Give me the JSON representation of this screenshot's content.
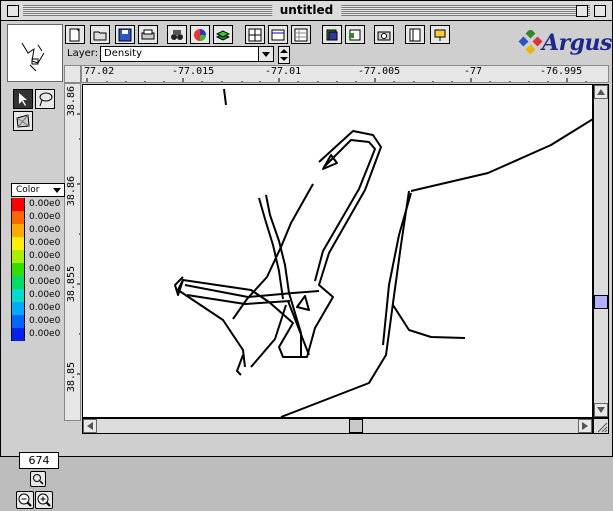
{
  "window": {
    "title": "untitled"
  },
  "toolbar": {
    "layer_label": "Layer:",
    "layer_value": "Density",
    "brand": "Argus"
  },
  "ruler_top": [
    "77.02",
    "-77.015",
    "-77.01",
    "-77.005",
    "-77",
    "-76.995"
  ],
  "ruler_left": [
    "38.86",
    "38.86",
    "38.855",
    "38.85"
  ],
  "palette": {
    "color_mode": "Color",
    "legend": [
      {
        "color": "#ff0000",
        "value": "0.00e0"
      },
      {
        "color": "#ff6600",
        "value": "0.00e0"
      },
      {
        "color": "#ffaa00",
        "value": "0.00e0"
      },
      {
        "color": "#ffee00",
        "value": "0.00e0"
      },
      {
        "color": "#aaee00",
        "value": "0.00e0"
      },
      {
        "color": "#33dd00",
        "value": "0.00e0"
      },
      {
        "color": "#00dd66",
        "value": "0.00e0"
      },
      {
        "color": "#00ddcc",
        "value": "0.00e0"
      },
      {
        "color": "#00aaff",
        "value": "0.00e0"
      },
      {
        "color": "#0066ff",
        "value": "0.00e0"
      },
      {
        "color": "#0022ee",
        "value": "0.00e0"
      }
    ],
    "zoom_value": "674"
  }
}
